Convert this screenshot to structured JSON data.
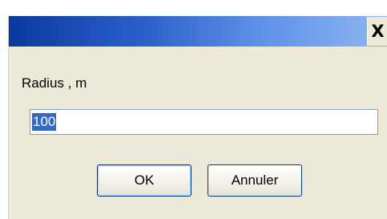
{
  "titlebar": {
    "close_glyph": "✕",
    "close_label": "X"
  },
  "form": {
    "label": "Radius , m",
    "value": "100"
  },
  "buttons": {
    "ok_label": "OK",
    "cancel_label": "Annuler"
  },
  "colors": {
    "titlebar_start": "#0a3aa0",
    "titlebar_end": "#8fb6f2",
    "dialog_bg": "#ece9d8",
    "selection": "#316ac5"
  }
}
